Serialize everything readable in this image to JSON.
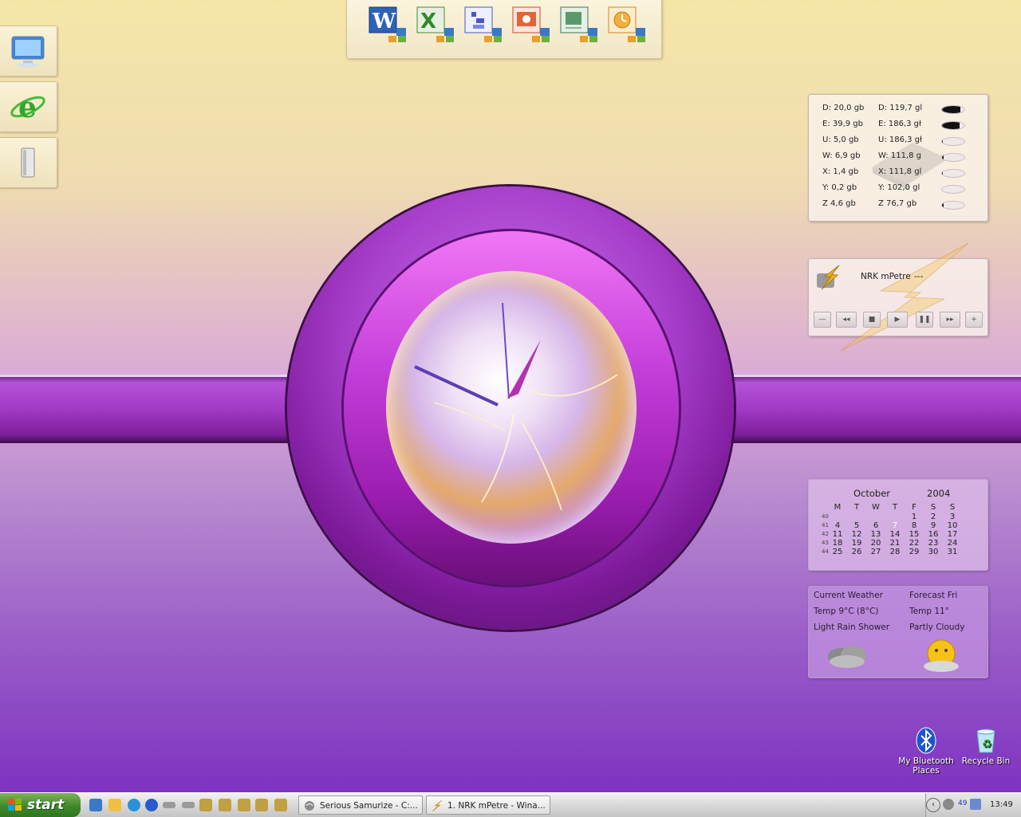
{
  "desktop": {
    "left_tiles": [
      {
        "icon": "my-computer-icon"
      },
      {
        "icon": "internet-explorer-icon"
      },
      {
        "icon": "recycle-bin-tile-icon"
      }
    ],
    "dock_icons": [
      "word-icon",
      "excel-icon",
      "project-icon",
      "powerpoint-icon",
      "publisher-icon",
      "outlook-icon"
    ],
    "clock": {
      "hour": 1,
      "minute": 49
    }
  },
  "disk_panel": {
    "rows": [
      {
        "free": "D: 20,0 gb",
        "total": "D: 119,7 gl",
        "used_fraction": 0.83
      },
      {
        "free": "E: 39,9 gb",
        "total": "E: 186,3 gł",
        "used_fraction": 0.79
      },
      {
        "free": "U: 5,0 gb",
        "total": "U: 186,3 gł",
        "used_fraction": 0.03
      },
      {
        "free": "W: 6,9 gb",
        "total": "W: 111,8 g",
        "used_fraction": 0.06
      },
      {
        "free": "X: 1,4 gb",
        "total": "X: 111,8 gl",
        "used_fraction": 0.01
      },
      {
        "free": "Y: 0,2 gb",
        "total": "Y: 102,0 gl",
        "used_fraction": 0.0
      },
      {
        "free": "Z 4,6 gb",
        "total": "Z 76,7 gb",
        "used_fraction": 0.06
      }
    ]
  },
  "media_player": {
    "station": "NRK mPetre",
    "status": "---",
    "buttons": [
      "—",
      "◂◂",
      "■",
      "▶",
      "❚❚",
      "▸▸",
      "+"
    ]
  },
  "calendar": {
    "month": "October",
    "year": "2004",
    "weekdays": [
      "M",
      "T",
      "W",
      "T",
      "F",
      "S",
      "S"
    ],
    "weeks": [
      {
        "wk": "40",
        "days": [
          "",
          "",
          "",
          "",
          "1",
          "2",
          "3"
        ]
      },
      {
        "wk": "41",
        "days": [
          "4",
          "5",
          "6",
          "7",
          "8",
          "9",
          "10"
        ]
      },
      {
        "wk": "42",
        "days": [
          "11",
          "12",
          "13",
          "14",
          "15",
          "16",
          "17"
        ]
      },
      {
        "wk": "43",
        "days": [
          "18",
          "19",
          "20",
          "21",
          "22",
          "23",
          "24"
        ]
      },
      {
        "wk": "44",
        "days": [
          "25",
          "26",
          "27",
          "28",
          "29",
          "30",
          "31"
        ]
      }
    ],
    "today": "7"
  },
  "weather": {
    "current_title": "Current Weather",
    "current_temp": "Temp 9°C (8°C)",
    "current_cond": "Light Rain Shower",
    "forecast_title": "Forecast Fri",
    "forecast_temp": "Temp 11°",
    "forecast_cond": "Partly Cloudy"
  },
  "desktop_icons": {
    "bluetooth": "My Bluetooth Places",
    "recycle": "Recycle Bin"
  },
  "taskbar": {
    "start_label": "start",
    "tasks": [
      "Serious Samurize - C:...",
      "1. NRK mPetre - Wina..."
    ],
    "tray_number": "49",
    "clock": "13:49"
  }
}
